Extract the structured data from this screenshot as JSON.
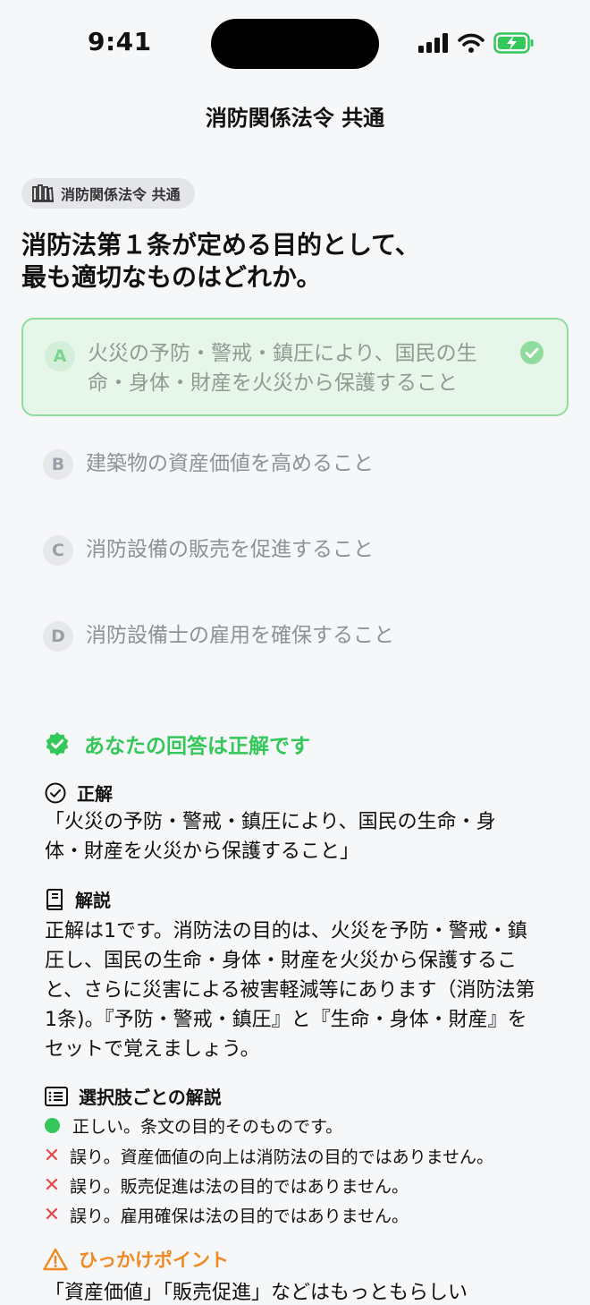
{
  "status": {
    "time": "9:41",
    "icons": [
      "signal-icon",
      "wifi-icon",
      "battery-charging-icon"
    ]
  },
  "nav": {
    "title": "消防関係法令 共通"
  },
  "tag": {
    "icon": "books-icon",
    "label": "消防関係法令 共通"
  },
  "question": {
    "text": "消防法第１条が定める目的として、最も適切なものはどれか。"
  },
  "options": [
    {
      "letter": "A",
      "text": "火災の予防・警戒・鎮圧により、国民の生命・身体・財産を火災から保護すること",
      "selected": true,
      "correct": true
    },
    {
      "letter": "B",
      "text": "建築物の資産価値を高めること"
    },
    {
      "letter": "C",
      "text": "消防設備の販売を促進すること"
    },
    {
      "letter": "D",
      "text": "消防設備士の雇用を確保すること"
    }
  ],
  "result": {
    "text": "あなたの回答は正解です",
    "icon": "verified-badge-icon",
    "color": "#34c759"
  },
  "answer": {
    "heading": "正解",
    "text": "「火災の予防・警戒・鎮圧により、国民の生命・身体・財産を火災から保護すること」"
  },
  "explanation": {
    "heading": "解説",
    "text": "正解は1です。消防法の目的は、火災を予防・警戒・鎮圧し、国民の生命・身体・財産を火災から保護すること、さらに災害による被害軽減等にあります（消防法第1条)。『予防・警戒・鎮圧』と『生命・身体・財産』をセットで覚えましょう。"
  },
  "per_option": {
    "heading": "選択肢ごとの解説",
    "items": [
      {
        "mark": "correct",
        "text": "正しい。条文の目的そのものです。"
      },
      {
        "mark": "wrong",
        "text": "誤り。資産価値の向上は消防法の目的ではありません。"
      },
      {
        "mark": "wrong",
        "text": "誤り。販売促進は法の目的ではありません。"
      },
      {
        "mark": "wrong",
        "text": "誤り。雇用確保は法の目的ではありません。"
      }
    ]
  },
  "trap": {
    "heading": "ひっかけポイント",
    "text": "「資産価値」「販売促進」などはもっともらしい",
    "color": "#f08a24"
  },
  "colors": {
    "accent_green": "#34c759",
    "wrong_red": "#e5484d",
    "warning_orange": "#f08a24",
    "background": "#f6f7f8"
  }
}
